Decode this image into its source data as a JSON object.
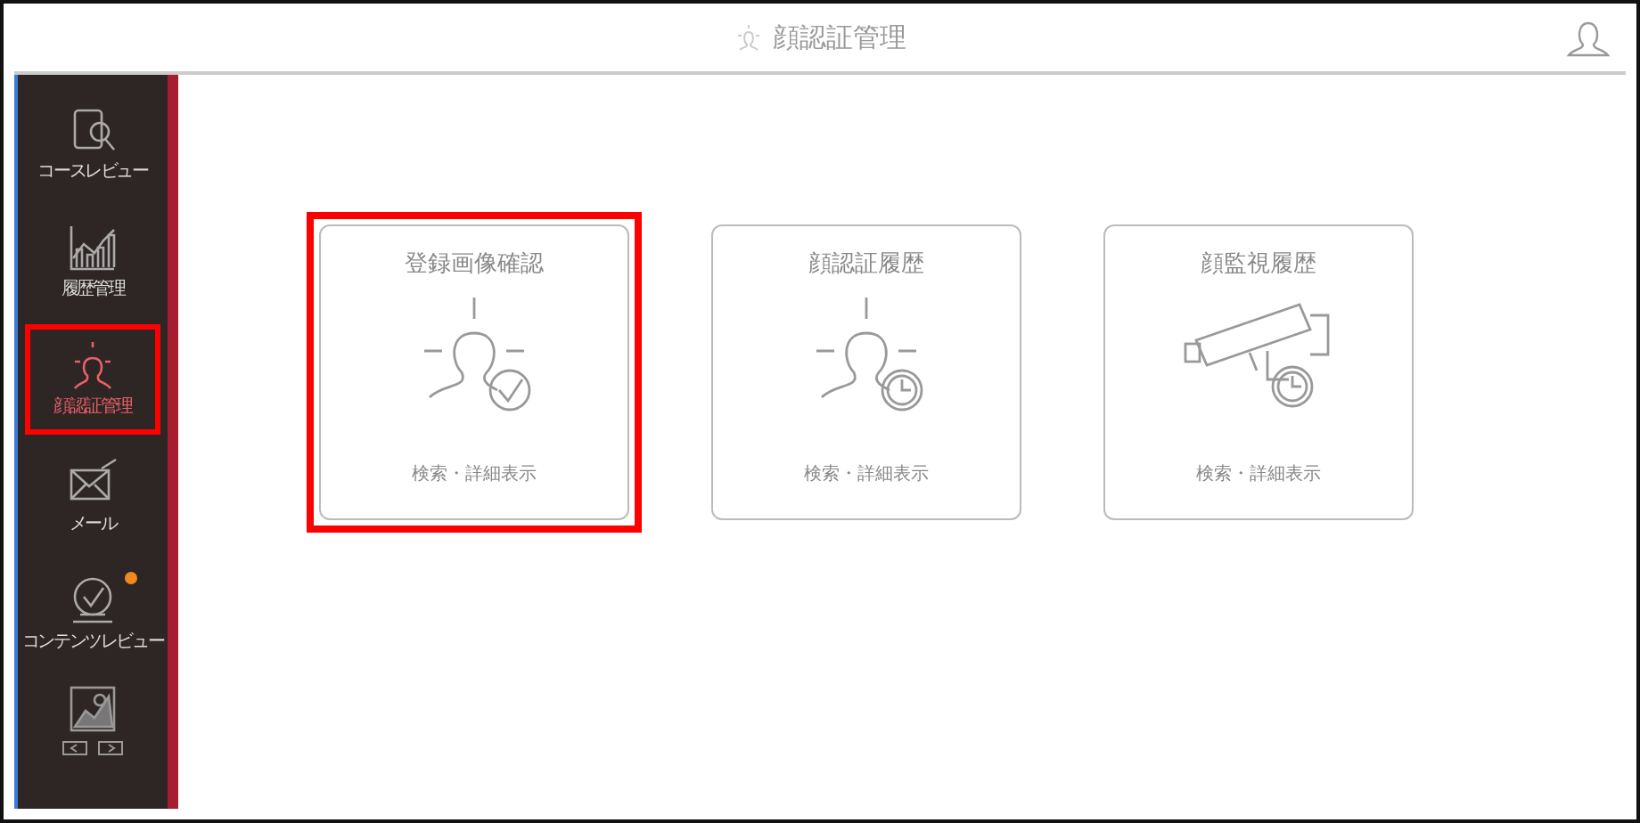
{
  "header": {
    "title": "顔認証管理"
  },
  "sidebar": {
    "items": [
      {
        "label": "コースレビュー",
        "kind": "book",
        "selected": false,
        "highlighted": false,
        "badge": false
      },
      {
        "label": "履歴管理",
        "kind": "chart",
        "selected": false,
        "highlighted": false,
        "badge": false
      },
      {
        "label": "顔認証管理",
        "kind": "face",
        "selected": true,
        "highlighted": true,
        "badge": false
      },
      {
        "label": "メール",
        "kind": "mail",
        "selected": false,
        "highlighted": false,
        "badge": false
      },
      {
        "label": "コンテンツレビュー",
        "kind": "review",
        "selected": false,
        "highlighted": false,
        "badge": true
      }
    ]
  },
  "cards": [
    {
      "title": "登録画像確認",
      "kind": "check",
      "caption": "検索・詳細表示",
      "highlighted": true
    },
    {
      "title": "顔認証履歴",
      "kind": "clock",
      "caption": "検索・詳細表示",
      "highlighted": false
    },
    {
      "title": "顔監視履歴",
      "kind": "camera",
      "caption": "検索・詳細表示",
      "highlighted": false
    }
  ]
}
